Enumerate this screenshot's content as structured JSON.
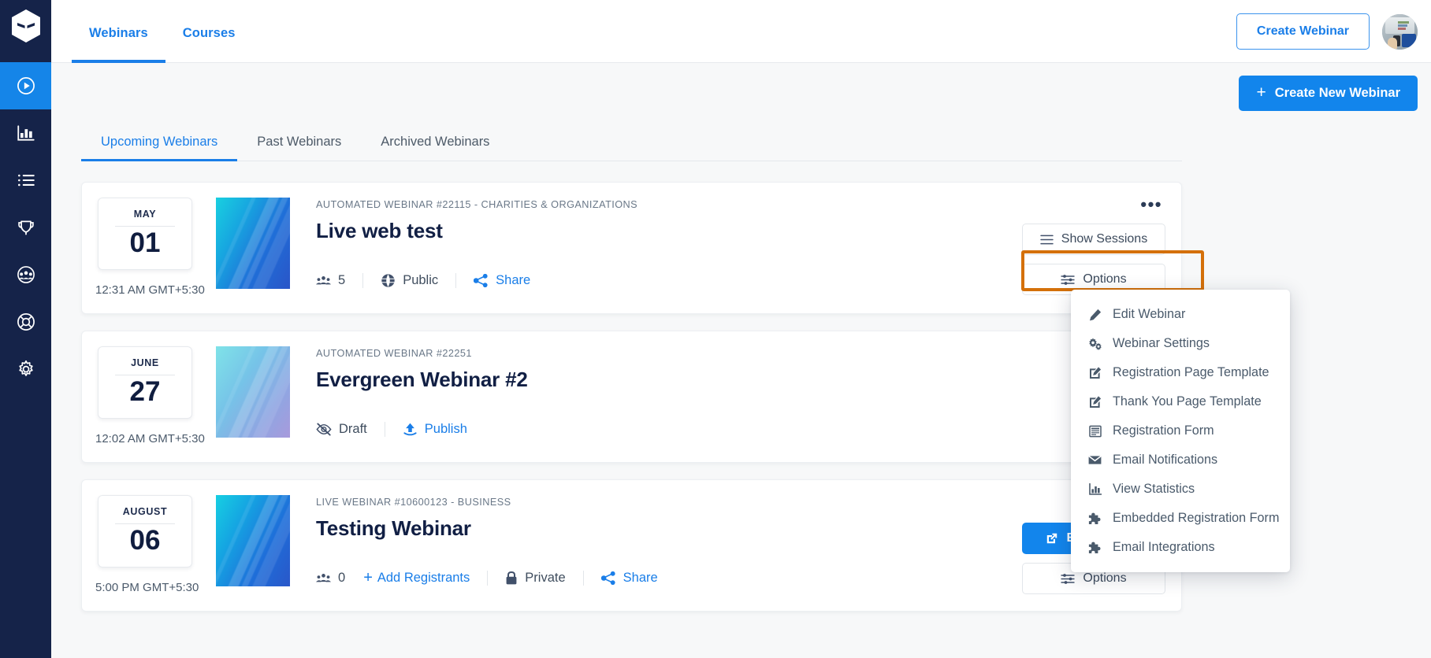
{
  "sidebar": {
    "logo_name": "app-logo",
    "items": [
      {
        "name": "webinars",
        "icon": "play-circle-icon",
        "active": true
      },
      {
        "name": "analytics",
        "icon": "bar-chart-icon",
        "active": false
      },
      {
        "name": "list",
        "icon": "list-icon",
        "active": false
      },
      {
        "name": "awards",
        "icon": "trophy-icon",
        "active": false
      },
      {
        "name": "audience",
        "icon": "users-group-icon",
        "active": false
      },
      {
        "name": "support",
        "icon": "lifebuoy-icon",
        "active": false
      },
      {
        "name": "settings",
        "icon": "gear-icon",
        "active": false
      }
    ]
  },
  "header": {
    "tabs": [
      {
        "label": "Webinars",
        "active": true
      },
      {
        "label": "Courses",
        "active": false
      }
    ],
    "create_webinar_label": "Create Webinar",
    "avatar_name": "user-avatar"
  },
  "toolbar": {
    "create_new_label": "Create New Webinar",
    "plus": "+"
  },
  "subtabs": [
    {
      "label": "Upcoming Webinars",
      "active": true
    },
    {
      "label": "Past Webinars",
      "active": false
    },
    {
      "label": "Archived Webinars",
      "active": false
    }
  ],
  "cards": [
    {
      "month": "MAY",
      "day": "01",
      "time": "12:31 AM GMT+5:30",
      "kicker": "AUTOMATED WEBINAR #22115 - CHARITIES & ORGANIZATIONS",
      "title": "Live web test",
      "attendees": "5",
      "visibility": "Public",
      "visibility_icon": "globe-icon",
      "share_label": "Share",
      "buttons": [
        {
          "label": "Show Sessions",
          "icon": "hamburger-icon",
          "primary": false
        },
        {
          "label": "Options",
          "icon": "sliders-icon",
          "primary": false
        }
      ],
      "kebab": "•••"
    },
    {
      "month": "JUNE",
      "day": "27",
      "time": "12:02 AM GMT+5:30",
      "kicker": "AUTOMATED WEBINAR #22251",
      "title": "Evergreen Webinar #2",
      "status": "Draft",
      "status_icon": "eye-slash-icon",
      "publish_label": "Publish",
      "publish_icon": "upload-icon"
    },
    {
      "month": "AUGUST",
      "day": "06",
      "time": "5:00 PM GMT+5:30",
      "kicker": "LIVE WEBINAR #10600123 - BUSINESS",
      "title": "Testing Webinar",
      "attendees": "0",
      "add_registrants_label": "Add Registrants",
      "visibility": "Private",
      "visibility_icon": "lock-icon",
      "share_label": "Share",
      "buttons": [
        {
          "label": "Enter Studio",
          "icon": "external-link-icon",
          "primary": true
        },
        {
          "label": "Options",
          "icon": "sliders-icon",
          "primary": false
        }
      ]
    }
  ],
  "options_menu": {
    "items": [
      {
        "label": "Edit Webinar",
        "icon": "pencil-icon"
      },
      {
        "label": "Webinar Settings",
        "icon": "gears-icon"
      },
      {
        "label": "Registration Page Template",
        "icon": "edit-square-icon"
      },
      {
        "label": "Thank You Page Template",
        "icon": "edit-square-icon"
      },
      {
        "label": "Registration Form",
        "icon": "form-icon"
      },
      {
        "label": "Email Notifications",
        "icon": "envelope-icon"
      },
      {
        "label": "View Statistics",
        "icon": "bar-chart-icon"
      },
      {
        "label": "Embedded Registration Form",
        "icon": "puzzle-icon"
      },
      {
        "label": "Email Integrations",
        "icon": "puzzle-icon"
      }
    ]
  },
  "colors": {
    "sidebar_bg": "#152349",
    "accent_blue": "#1285ec",
    "link_blue": "#1a7ee8",
    "highlight_orange": "#d4700a",
    "page_bg": "#f7f8f9",
    "title_navy": "#111f44"
  }
}
